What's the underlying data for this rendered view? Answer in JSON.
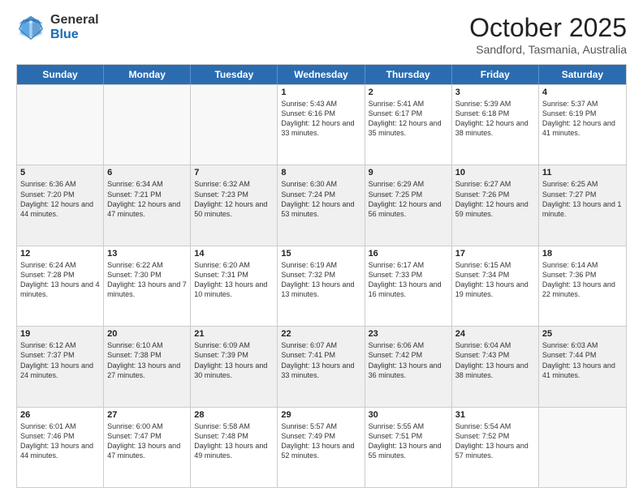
{
  "header": {
    "logo_general": "General",
    "logo_blue": "Blue",
    "month_title": "October 2025",
    "subtitle": "Sandford, Tasmania, Australia"
  },
  "calendar": {
    "days_of_week": [
      "Sunday",
      "Monday",
      "Tuesday",
      "Wednesday",
      "Thursday",
      "Friday",
      "Saturday"
    ],
    "rows": [
      [
        {
          "day": "",
          "info": ""
        },
        {
          "day": "",
          "info": ""
        },
        {
          "day": "",
          "info": ""
        },
        {
          "day": "1",
          "info": "Sunrise: 5:43 AM\nSunset: 6:16 PM\nDaylight: 12 hours and 33 minutes."
        },
        {
          "day": "2",
          "info": "Sunrise: 5:41 AM\nSunset: 6:17 PM\nDaylight: 12 hours and 35 minutes."
        },
        {
          "day": "3",
          "info": "Sunrise: 5:39 AM\nSunset: 6:18 PM\nDaylight: 12 hours and 38 minutes."
        },
        {
          "day": "4",
          "info": "Sunrise: 5:37 AM\nSunset: 6:19 PM\nDaylight: 12 hours and 41 minutes."
        }
      ],
      [
        {
          "day": "5",
          "info": "Sunrise: 6:36 AM\nSunset: 7:20 PM\nDaylight: 12 hours and 44 minutes."
        },
        {
          "day": "6",
          "info": "Sunrise: 6:34 AM\nSunset: 7:21 PM\nDaylight: 12 hours and 47 minutes."
        },
        {
          "day": "7",
          "info": "Sunrise: 6:32 AM\nSunset: 7:23 PM\nDaylight: 12 hours and 50 minutes."
        },
        {
          "day": "8",
          "info": "Sunrise: 6:30 AM\nSunset: 7:24 PM\nDaylight: 12 hours and 53 minutes."
        },
        {
          "day": "9",
          "info": "Sunrise: 6:29 AM\nSunset: 7:25 PM\nDaylight: 12 hours and 56 minutes."
        },
        {
          "day": "10",
          "info": "Sunrise: 6:27 AM\nSunset: 7:26 PM\nDaylight: 12 hours and 59 minutes."
        },
        {
          "day": "11",
          "info": "Sunrise: 6:25 AM\nSunset: 7:27 PM\nDaylight: 13 hours and 1 minute."
        }
      ],
      [
        {
          "day": "12",
          "info": "Sunrise: 6:24 AM\nSunset: 7:28 PM\nDaylight: 13 hours and 4 minutes."
        },
        {
          "day": "13",
          "info": "Sunrise: 6:22 AM\nSunset: 7:30 PM\nDaylight: 13 hours and 7 minutes."
        },
        {
          "day": "14",
          "info": "Sunrise: 6:20 AM\nSunset: 7:31 PM\nDaylight: 13 hours and 10 minutes."
        },
        {
          "day": "15",
          "info": "Sunrise: 6:19 AM\nSunset: 7:32 PM\nDaylight: 13 hours and 13 minutes."
        },
        {
          "day": "16",
          "info": "Sunrise: 6:17 AM\nSunset: 7:33 PM\nDaylight: 13 hours and 16 minutes."
        },
        {
          "day": "17",
          "info": "Sunrise: 6:15 AM\nSunset: 7:34 PM\nDaylight: 13 hours and 19 minutes."
        },
        {
          "day": "18",
          "info": "Sunrise: 6:14 AM\nSunset: 7:36 PM\nDaylight: 13 hours and 22 minutes."
        }
      ],
      [
        {
          "day": "19",
          "info": "Sunrise: 6:12 AM\nSunset: 7:37 PM\nDaylight: 13 hours and 24 minutes."
        },
        {
          "day": "20",
          "info": "Sunrise: 6:10 AM\nSunset: 7:38 PM\nDaylight: 13 hours and 27 minutes."
        },
        {
          "day": "21",
          "info": "Sunrise: 6:09 AM\nSunset: 7:39 PM\nDaylight: 13 hours and 30 minutes."
        },
        {
          "day": "22",
          "info": "Sunrise: 6:07 AM\nSunset: 7:41 PM\nDaylight: 13 hours and 33 minutes."
        },
        {
          "day": "23",
          "info": "Sunrise: 6:06 AM\nSunset: 7:42 PM\nDaylight: 13 hours and 36 minutes."
        },
        {
          "day": "24",
          "info": "Sunrise: 6:04 AM\nSunset: 7:43 PM\nDaylight: 13 hours and 38 minutes."
        },
        {
          "day": "25",
          "info": "Sunrise: 6:03 AM\nSunset: 7:44 PM\nDaylight: 13 hours and 41 minutes."
        }
      ],
      [
        {
          "day": "26",
          "info": "Sunrise: 6:01 AM\nSunset: 7:46 PM\nDaylight: 13 hours and 44 minutes."
        },
        {
          "day": "27",
          "info": "Sunrise: 6:00 AM\nSunset: 7:47 PM\nDaylight: 13 hours and 47 minutes."
        },
        {
          "day": "28",
          "info": "Sunrise: 5:58 AM\nSunset: 7:48 PM\nDaylight: 13 hours and 49 minutes."
        },
        {
          "day": "29",
          "info": "Sunrise: 5:57 AM\nSunset: 7:49 PM\nDaylight: 13 hours and 52 minutes."
        },
        {
          "day": "30",
          "info": "Sunrise: 5:55 AM\nSunset: 7:51 PM\nDaylight: 13 hours and 55 minutes."
        },
        {
          "day": "31",
          "info": "Sunrise: 5:54 AM\nSunset: 7:52 PM\nDaylight: 13 hours and 57 minutes."
        },
        {
          "day": "",
          "info": ""
        }
      ]
    ]
  }
}
